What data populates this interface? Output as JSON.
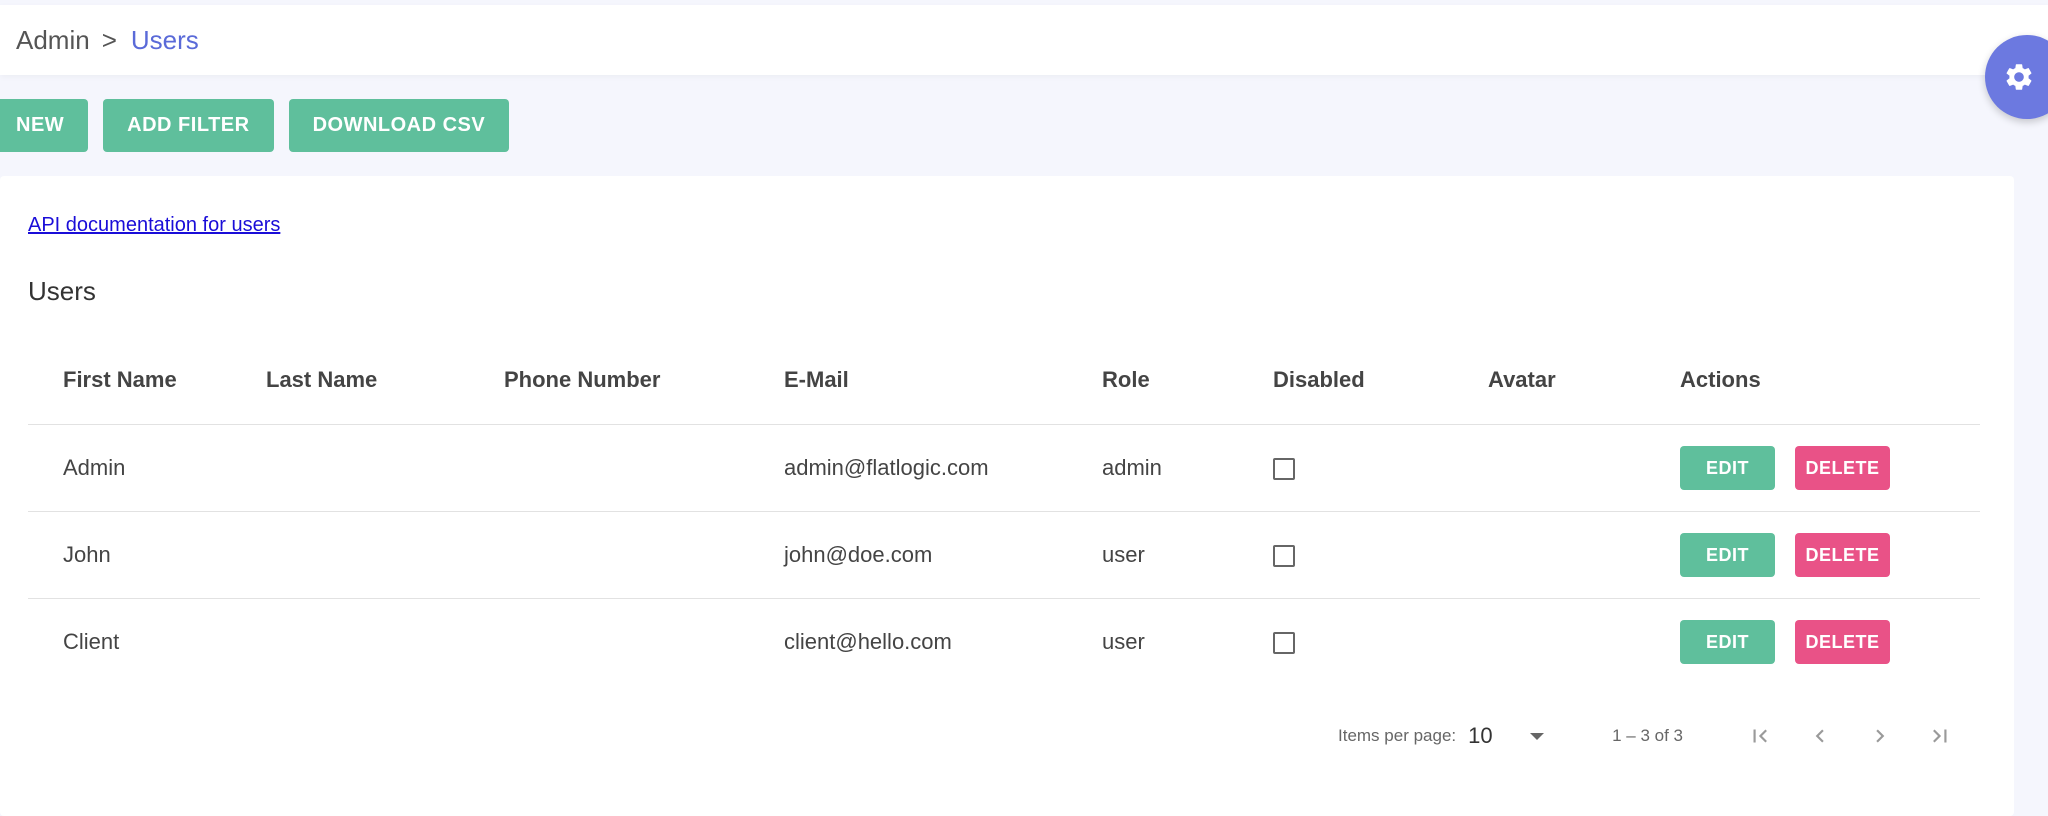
{
  "breadcrumb": {
    "root": "Admin",
    "separator": ">",
    "current": "Users"
  },
  "toolbar": {
    "new_label": "NEW",
    "add_filter_label": "ADD FILTER",
    "download_csv_label": "DOWNLOAD CSV"
  },
  "api_link": "API documentation for users",
  "section_title": "Users",
  "table": {
    "headers": [
      "First Name",
      "Last Name",
      "Phone Number",
      "E-Mail",
      "Role",
      "Disabled",
      "Avatar",
      "Actions"
    ],
    "rows": [
      {
        "first_name": "Admin",
        "last_name": "",
        "phone": "",
        "email": "admin@flatlogic.com",
        "role": "admin",
        "disabled": false,
        "avatar": ""
      },
      {
        "first_name": "John",
        "last_name": "",
        "phone": "",
        "email": "john@doe.com",
        "role": "user",
        "disabled": false,
        "avatar": ""
      },
      {
        "first_name": "Client",
        "last_name": "",
        "phone": "",
        "email": "client@hello.com",
        "role": "user",
        "disabled": false,
        "avatar": ""
      }
    ],
    "edit_label": "EDIT",
    "delete_label": "DELETE"
  },
  "pagination": {
    "items_per_page_label": "Items per page:",
    "items_per_page": "10",
    "range": "1 – 3 of 3"
  },
  "colors": {
    "accent": "#5a6ad8",
    "teal": "#5fbf9c",
    "pink": "#e95287",
    "fab": "#6c79e0"
  },
  "icons": {
    "settings": "gear-icon",
    "first_page": "first-page-icon",
    "prev_page": "chevron-left-icon",
    "next_page": "chevron-right-icon",
    "last_page": "last-page-icon"
  }
}
